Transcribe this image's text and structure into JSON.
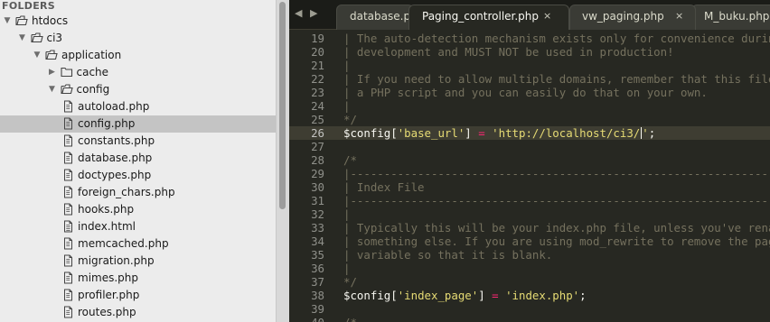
{
  "sidebar": {
    "header": "FOLDERS",
    "items": [
      {
        "label": "htdocs",
        "depth": 0,
        "type": "folder",
        "expanded": true
      },
      {
        "label": "ci3",
        "depth": 1,
        "type": "folder",
        "expanded": true
      },
      {
        "label": "application",
        "depth": 2,
        "type": "folder",
        "expanded": true
      },
      {
        "label": "cache",
        "depth": 3,
        "type": "folder",
        "expanded": false
      },
      {
        "label": "config",
        "depth": 3,
        "type": "folder",
        "expanded": true
      },
      {
        "label": "autoload.php",
        "depth": 4,
        "type": "file"
      },
      {
        "label": "config.php",
        "depth": 4,
        "type": "file",
        "selected": true
      },
      {
        "label": "constants.php",
        "depth": 4,
        "type": "file"
      },
      {
        "label": "database.php",
        "depth": 4,
        "type": "file"
      },
      {
        "label": "doctypes.php",
        "depth": 4,
        "type": "file"
      },
      {
        "label": "foreign_chars.php",
        "depth": 4,
        "type": "file"
      },
      {
        "label": "hooks.php",
        "depth": 4,
        "type": "file"
      },
      {
        "label": "index.html",
        "depth": 4,
        "type": "file-html"
      },
      {
        "label": "memcached.php",
        "depth": 4,
        "type": "file"
      },
      {
        "label": "migration.php",
        "depth": 4,
        "type": "file"
      },
      {
        "label": "mimes.php",
        "depth": 4,
        "type": "file"
      },
      {
        "label": "profiler.php",
        "depth": 4,
        "type": "file"
      },
      {
        "label": "routes.php",
        "depth": 4,
        "type": "file"
      }
    ]
  },
  "tabbar": {
    "prev_icon": "◀",
    "next_icon": "▶",
    "tabs": [
      {
        "label": "database.php",
        "close": "",
        "active": false
      },
      {
        "label": "Paging_controller.php",
        "close": "×",
        "active": true
      },
      {
        "label": "vw_paging.php",
        "close": "×",
        "active": false
      },
      {
        "label": "M_buku.php",
        "close": "",
        "active": false
      }
    ]
  },
  "editor": {
    "lines": [
      {
        "num": "19",
        "tokens": [
          [
            "c",
            "| The auto-detection mechanism exists only for convenience during"
          ]
        ]
      },
      {
        "num": "20",
        "tokens": [
          [
            "c",
            "| development and MUST NOT be used in production!"
          ]
        ]
      },
      {
        "num": "21",
        "tokens": [
          [
            "c",
            "|"
          ]
        ]
      },
      {
        "num": "22",
        "tokens": [
          [
            "c",
            "| If you need to allow multiple domains, remember that this file is still"
          ]
        ]
      },
      {
        "num": "23",
        "tokens": [
          [
            "c",
            "| a PHP script and you can easily do that on your own."
          ]
        ]
      },
      {
        "num": "24",
        "tokens": [
          [
            "c",
            "|"
          ]
        ]
      },
      {
        "num": "25",
        "tokens": [
          [
            "c",
            "*/"
          ]
        ]
      },
      {
        "num": "26",
        "current": true,
        "tokens": [
          [
            "v",
            "$config["
          ],
          [
            "s",
            "'base_url'"
          ],
          [
            "v",
            "] "
          ],
          [
            "o",
            "="
          ],
          [
            "v",
            " "
          ],
          [
            "s",
            "'http://localhost/ci3/"
          ],
          [
            "caret",
            ""
          ],
          [
            "s",
            "'"
          ],
          [
            "v",
            ";"
          ]
        ]
      },
      {
        "num": "27",
        "tokens": []
      },
      {
        "num": "28",
        "tokens": [
          [
            "c",
            "/*"
          ]
        ]
      },
      {
        "num": "29",
        "tokens": [
          [
            "c",
            "|--------------------------------------------------------------------------"
          ]
        ]
      },
      {
        "num": "30",
        "tokens": [
          [
            "c",
            "| Index File"
          ]
        ]
      },
      {
        "num": "31",
        "tokens": [
          [
            "c",
            "|--------------------------------------------------------------------------"
          ]
        ]
      },
      {
        "num": "32",
        "tokens": [
          [
            "c",
            "|"
          ]
        ]
      },
      {
        "num": "33",
        "tokens": [
          [
            "c",
            "| Typically this will be your index.php file, unless you've renamed it to"
          ]
        ]
      },
      {
        "num": "34",
        "tokens": [
          [
            "c",
            "| something else. If you are using mod_rewrite to remove the page set this"
          ]
        ]
      },
      {
        "num": "35",
        "tokens": [
          [
            "c",
            "| variable so that it is blank."
          ]
        ]
      },
      {
        "num": "36",
        "tokens": [
          [
            "c",
            "|"
          ]
        ]
      },
      {
        "num": "37",
        "tokens": [
          [
            "c",
            "*/"
          ]
        ]
      },
      {
        "num": "38",
        "tokens": [
          [
            "v",
            "$config["
          ],
          [
            "s",
            "'index_page'"
          ],
          [
            "v",
            "] "
          ],
          [
            "o",
            "="
          ],
          [
            "v",
            " "
          ],
          [
            "s",
            "'index.php'"
          ],
          [
            "v",
            ";"
          ]
        ]
      },
      {
        "num": "39",
        "tokens": []
      },
      {
        "num": "40",
        "tokens": [
          [
            "c",
            "/*"
          ]
        ]
      }
    ]
  },
  "colors": {
    "sidebar_bg": "#ececec",
    "selected_row": "#c4c4c4",
    "editor_bg": "#272822",
    "comment": "#75715e",
    "string": "#e6db74",
    "operator": "#f92672"
  }
}
